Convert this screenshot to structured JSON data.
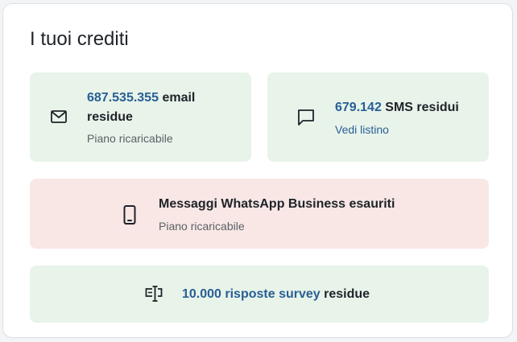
{
  "card": {
    "title": "I tuoi crediti"
  },
  "email": {
    "count": "687.535.355",
    "label": "email residue",
    "plan": "Piano ricaricabile",
    "icon": "mail-icon"
  },
  "sms": {
    "count": "679.142",
    "label": "SMS residui",
    "link": "Vedi listino",
    "icon": "chat-bubble-icon"
  },
  "whatsapp": {
    "label": "Messaggi WhatsApp Business esauriti",
    "plan": "Piano ricaricabile",
    "icon": "smartphone-icon"
  },
  "survey": {
    "count": "10.000 risposte survey",
    "label": "residue",
    "icon": "survey-form-icon"
  },
  "colors": {
    "accent": "#285f94",
    "tile_ok": "#e8f3ea",
    "tile_empty": "#f8e7e5"
  }
}
